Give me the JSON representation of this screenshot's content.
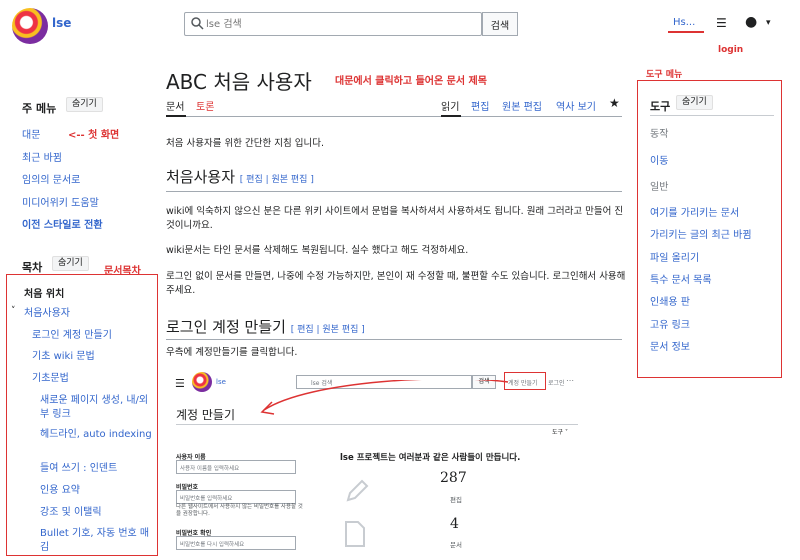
{
  "header": {
    "logo_text": "lse",
    "search_placeholder": "lse 검색",
    "search_button": "검색",
    "user_link": "Hs...",
    "login_annotation": "login"
  },
  "left_menu": {
    "heading": "주 메뉴",
    "hide": "숨기기",
    "items": [
      "대문",
      "최근 바뀜",
      "임의의 문서로",
      "미디어위키 도움말",
      "이전 스타일로 전환"
    ],
    "home_annotation": "<-- 첫 화면"
  },
  "toc": {
    "heading": "목차",
    "hide": "숨기기",
    "annotation": "문서목차",
    "top": "처음 위치",
    "section": "처음사용자",
    "items": [
      "로그인 계정 만들기",
      "기초 wiki 문법",
      "기초문법"
    ],
    "sub_items": [
      "새로운 페이지 생성, 내/외부 링크",
      "헤드라인, auto indexing",
      "들여 쓰기 : 인덴트",
      "인용 요약",
      "강조 및 이탤릭",
      "Bullet 기호, 자동 번호 매김"
    ]
  },
  "main": {
    "title": "ABC 처음 사용자",
    "title_annotation": "대문에서 클릭하고 들어온 문서 제목",
    "tabs": {
      "doc": "문서",
      "talk": "토론",
      "read": "읽기",
      "edit": "편집",
      "source_edit": "원본 편집",
      "history": "역사 보기"
    },
    "intro": "처음 사용자를 위한 간단한 지침 입니다.",
    "section1_title": "처음사용자",
    "edit_links": "[ 편집 | 원본 편집 ]",
    "para1": "wiki에 익숙하지 않으신 분은 다른 위키 사이트에서 문법을 복사하셔서 사용하셔도 됩니다. 원래 그러라고 만들어 진 것이니까요.",
    "para2": "wiki문서는 타인 문서를 삭제해도 복원됩니다. 실수 했다고 해도 걱정하세요.",
    "para3": "로그인 없이 문서를 만들면, 나중에 수정 가능하지만, 본인이 재 수정할 때, 불편할 수도 있습니다. 로그인해서 사용해 주세요.",
    "section2_title": "로그인 계정 만들기",
    "para4": "우측에 계정만들기를 클릭합니다."
  },
  "screenshot": {
    "logo_text": "lse",
    "search_placeholder": "lse 검색",
    "search_button": "검색",
    "create_account": "계정 만들기",
    "login": "로그인",
    "title": "계정 만들기",
    "tools": "도구 ˅",
    "username_label": "사용자 이름",
    "username_placeholder": "사용자 이름을 입력하세요",
    "password_label": "비밀번호",
    "password_placeholder": "비밀번호를 입력하세요",
    "password_help": "다른 웹사이트에서 사용하지 않는 비밀번호를 사용할 것을 권장합니다.",
    "confirm_label": "비밀번호 확인",
    "confirm_placeholder": "비밀번호를 다시 입력하세요",
    "heading": "lse 프로젝트는 여러분과 같은 사람들이 만듭니다.",
    "stat1_num": "287",
    "stat1_label": "편집",
    "stat2_num": "4",
    "stat2_label": "문서"
  },
  "tools": {
    "annotation": "도구 메뉴",
    "heading": "도구",
    "hide": "숨기기",
    "sub_action": "동작",
    "move": "이동",
    "sub_general": "일반",
    "items": [
      "여기를 가리키는 문서",
      "가리키는 글의 최근 바뀜",
      "파일 올리기",
      "특수 문서 목록",
      "인쇄용 판",
      "고유 링크",
      "문서 정보"
    ]
  },
  "colors": {
    "link": "#3366cc",
    "annotation": "#dd3333",
    "text": "#202122"
  }
}
